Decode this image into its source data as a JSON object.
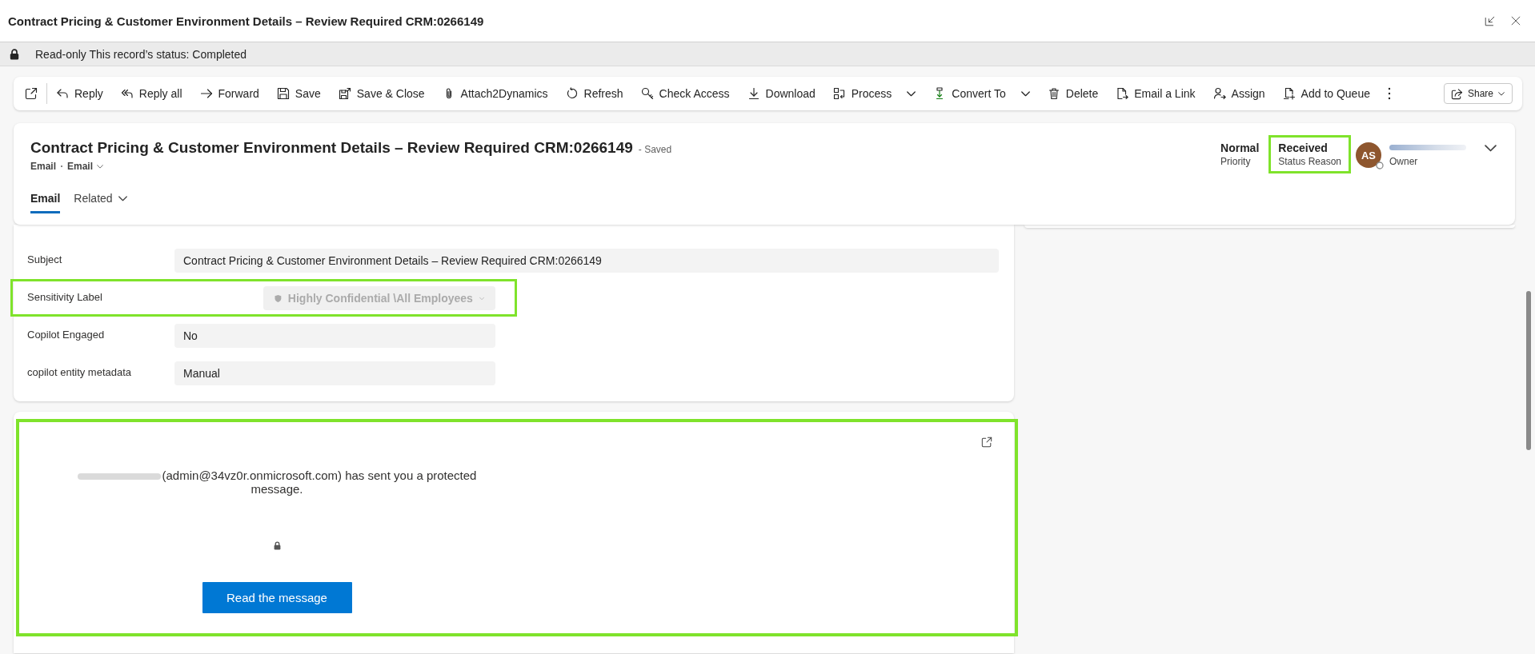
{
  "window": {
    "title": "Contract Pricing & Customer Environment Details – Review Required CRM:0266149"
  },
  "notice_bar": {
    "text": "Read-only This record’s status: Completed"
  },
  "toolbar": {
    "items": [
      {
        "label": "Reply",
        "menu": false
      },
      {
        "label": "Reply all",
        "menu": false
      },
      {
        "label": "Forward",
        "menu": false
      },
      {
        "label": "Save",
        "menu": false
      },
      {
        "label": "Save & Close",
        "menu": false
      },
      {
        "label": "Attach2Dynamics",
        "menu": false
      },
      {
        "label": "Refresh",
        "menu": false
      },
      {
        "label": "Check Access",
        "menu": false
      },
      {
        "label": "Download",
        "menu": false
      },
      {
        "label": "Process",
        "menu": true
      },
      {
        "label": "Convert To",
        "menu": true
      },
      {
        "label": "Delete",
        "menu": false
      },
      {
        "label": "Email a Link",
        "menu": false
      },
      {
        "label": "Assign",
        "menu": false
      },
      {
        "label": "Add to Queue",
        "menu": false
      }
    ],
    "share": {
      "label": "Share"
    }
  },
  "record_header": {
    "title": "Contract Pricing & Customer Environment Details – Review Required CRM:0266149",
    "save_state": "- Saved",
    "entity": "Email",
    "form_selector": "Email",
    "tabs": [
      {
        "label": "Email",
        "selected": true,
        "menu": false
      },
      {
        "label": "Related",
        "selected": false,
        "menu": true
      }
    ],
    "fields": [
      {
        "value": "Normal",
        "label": "Priority",
        "highlighted": false
      },
      {
        "value": "Received",
        "label": "Status Reason",
        "highlighted": true
      }
    ],
    "owner": {
      "initials": "AS",
      "label": "Owner"
    }
  },
  "form": {
    "fields": [
      {
        "kind": "long_text",
        "label": "Subject",
        "value": "Contract Pricing & Customer Environment Details – Review Required CRM:0266149",
        "disabled": false,
        "highlighted": false
      },
      {
        "kind": "sensitivity",
        "label": "Sensitivity Label",
        "value": "Highly Confidential \\All Employees",
        "disabled": true,
        "highlighted": true
      },
      {
        "kind": "text",
        "label": "Copilot Engaged",
        "value": "No",
        "disabled": false,
        "highlighted": false
      },
      {
        "kind": "text",
        "label": "copilot entity metadata",
        "value": "Manual",
        "disabled": false,
        "highlighted": false
      }
    ]
  },
  "message": {
    "text": "(admin@34vz0r.onmicrosoft.com) has sent you a protected message.",
    "button": "Read the message",
    "highlighted": true
  }
}
